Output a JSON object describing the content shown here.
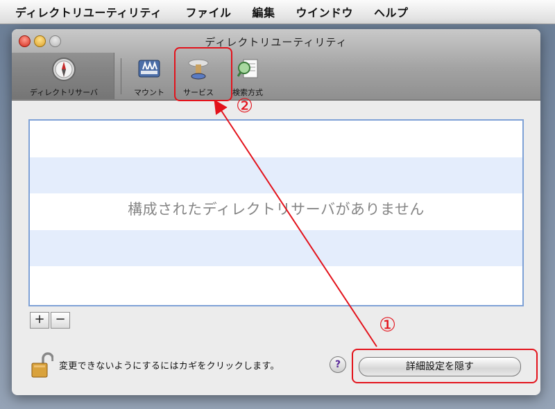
{
  "menubar": {
    "app": "ディレクトリユーティリティ",
    "items": [
      "ファイル",
      "編集",
      "ウインドウ",
      "ヘルプ"
    ]
  },
  "window": {
    "title": "ディレクトリユーティリティ"
  },
  "toolbar": {
    "items": [
      {
        "label": "ディレクトリサーバ",
        "icon": "compass-icon",
        "selected": true
      },
      {
        "label": "マウント",
        "icon": "mount-icon"
      },
      {
        "label": "サービス",
        "icon": "services-icon"
      },
      {
        "label": "検索方式",
        "icon": "search-policy-icon"
      }
    ]
  },
  "list": {
    "empty_message": "構成されたディレクトリサーバがありません"
  },
  "controls": {
    "add": "+",
    "remove": "−"
  },
  "lock": {
    "text": "変更できないようにするにはカギをクリックします。"
  },
  "help": {
    "label": "?"
  },
  "advanced_button": {
    "label": "詳細設定を隠す"
  },
  "annotations": {
    "step1": "①",
    "step2": "②",
    "color": "#e3121b"
  }
}
